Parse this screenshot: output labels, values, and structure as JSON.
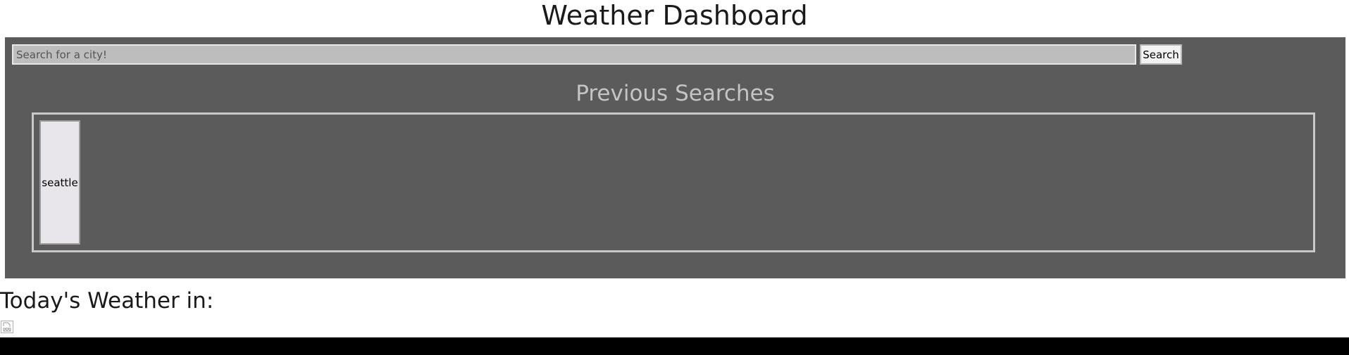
{
  "header": {
    "title": "Weather Dashboard"
  },
  "search": {
    "placeholder": "Search for a city!",
    "value": "",
    "button_label": "Search"
  },
  "previous_searches": {
    "title": "Previous Searches",
    "items": [
      {
        "label": "seattle"
      }
    ]
  },
  "today": {
    "heading": "Today's Weather in:",
    "icon": "broken-image-icon"
  },
  "colors": {
    "panel_background": "#5b5b5b",
    "input_background": "#bdbdbd",
    "previous_title": "#c4c4c4",
    "border": "#c8c8c8"
  }
}
